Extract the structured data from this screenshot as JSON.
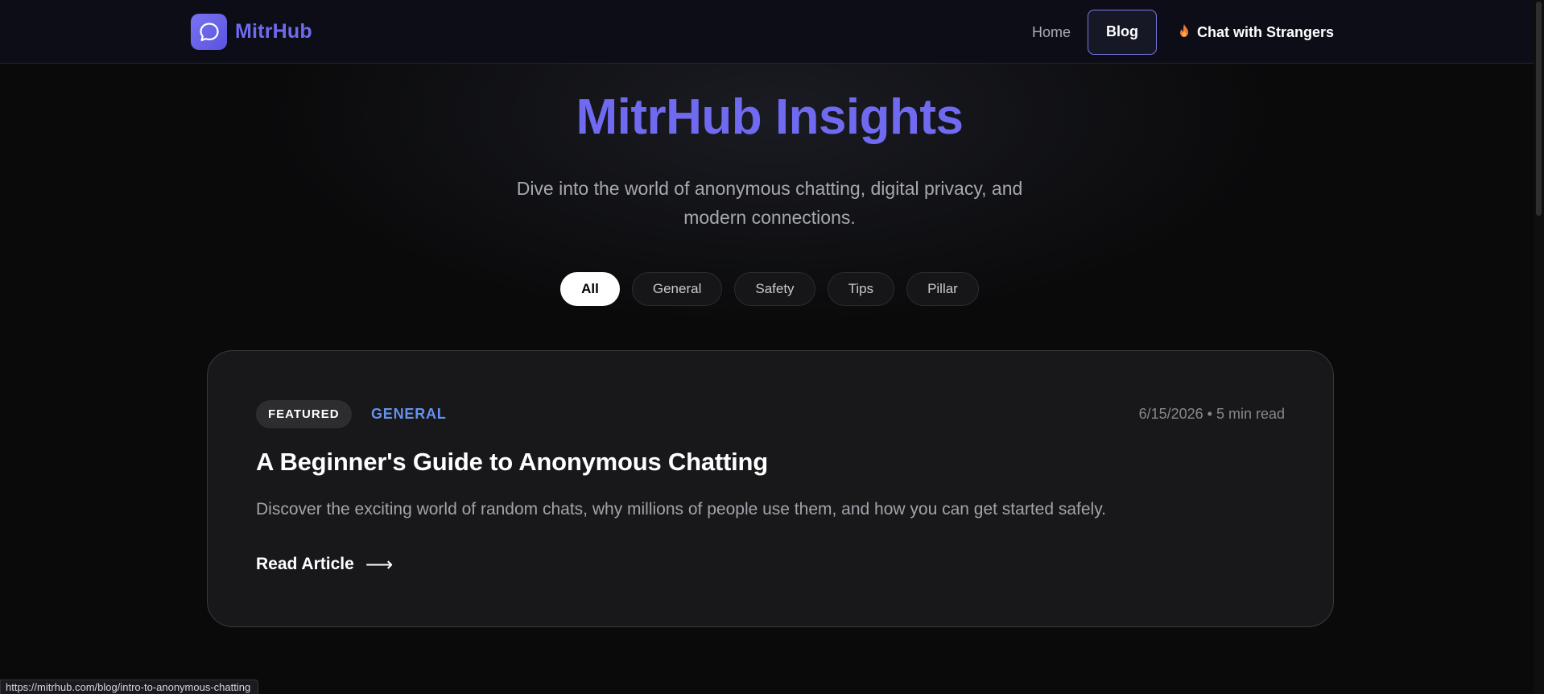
{
  "header": {
    "brand": "MitrHub",
    "nav": {
      "home": "Home",
      "blog": "Blog",
      "cta": "Chat with Strangers"
    }
  },
  "hero": {
    "title": "MitrHub Insights",
    "subtitle": "Dive into the world of anonymous chatting, digital privacy, and modern connections."
  },
  "filters": {
    "items": [
      "All",
      "General",
      "Safety",
      "Tips",
      "Pillar"
    ],
    "active": "All"
  },
  "featured_post": {
    "badge": "FEATURED",
    "category": "GENERAL",
    "meta": "6/15/2026 • 5 min read",
    "title": "A Beginner's Guide to Anonymous Chatting",
    "description": "Discover the exciting world of random chats, why millions of people use them, and how you can get started safely.",
    "read_label": "Read Article",
    "read_arrow": "⟶"
  },
  "status_bar": {
    "url": "https://mitrhub.com/blog/intro-to-anonymous-chatting"
  },
  "colors": {
    "accent": "#6f6af0",
    "category": "#6492ec",
    "background": "#0a0a0b",
    "card": "#18181a"
  },
  "icons": {
    "logo": "chat-bubble-icon",
    "cta": "fire-icon"
  }
}
